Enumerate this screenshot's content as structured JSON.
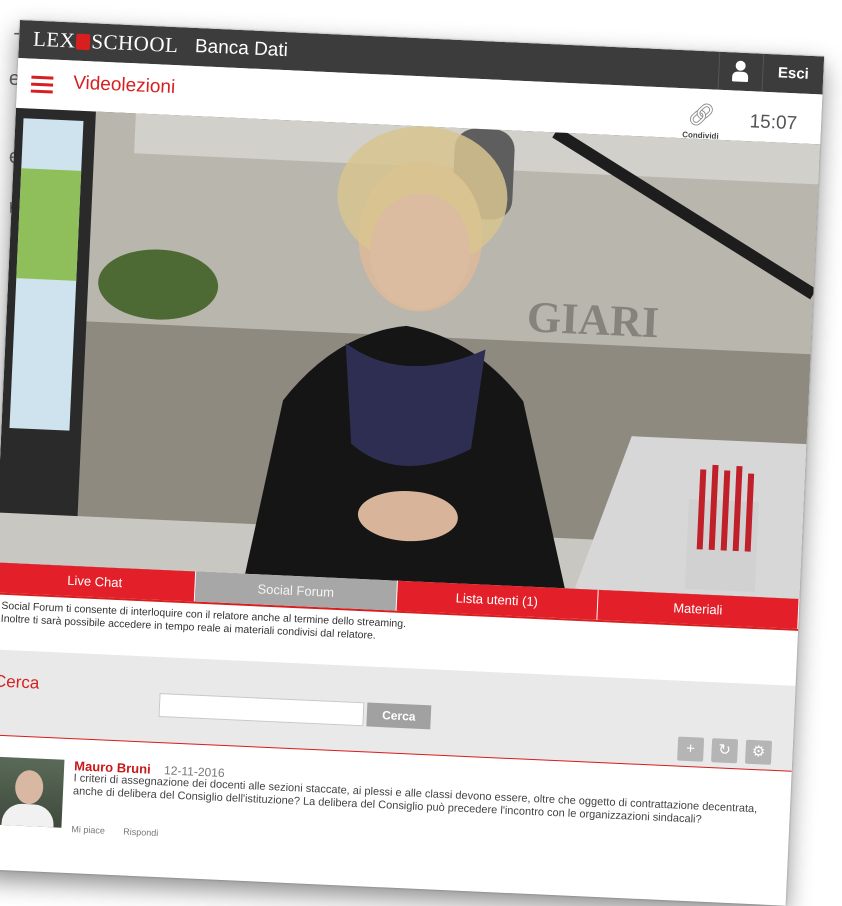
{
  "header": {
    "brand": "LEXSCHOOL",
    "brand_parts": [
      "LEX",
      "SCHOOL"
    ],
    "subtitle": "Banca Dati",
    "user_icon": "user-icon",
    "exit_label": "Esci"
  },
  "titlebar": {
    "title": "Videolezioni",
    "share_label": "Condividi",
    "time": "15:07"
  },
  "video": {
    "wall_text": "GIARI"
  },
  "tabs": [
    {
      "label": "Live Chat",
      "active": false
    },
    {
      "label": "Social Forum",
      "active": true
    },
    {
      "label": "Lista utenti  (1)",
      "active": false
    },
    {
      "label": "Materiali",
      "active": false
    }
  ],
  "info": {
    "line1": "Social Forum ti consente di interloquire con il relatore anche al termine dello streaming.",
    "line2": "Inoltre ti sarà possibile accedere in tempo reale ai materiali condivisi dal relatore."
  },
  "search": {
    "label": "Cerca",
    "value": "",
    "button_label": "Cerca",
    "tool_add": "+",
    "tool_refresh": "↻",
    "tool_settings": "⚙"
  },
  "comment": {
    "author": "Mauro Bruni",
    "date": "12-11-2016",
    "text": "I criteri di assegnazione dei docenti alle sezioni staccate, ai plessi e alle classi devono essere, oltre che oggetto di contrattazione decentrata, anche di delibera del Consiglio dell'istituzione? La delibera del Consiglio può precedere l'incontro con le organizzazioni sindacali?",
    "like_label": "Mi piace",
    "reply_label": "Rispondi"
  },
  "background_text": [
    "-",
    "e",
    "e",
    "i",
    "n"
  ],
  "colors": {
    "accent": "#d81e1e",
    "tab_red": "#e3202a",
    "tab_inactive": "#a7a7a7",
    "topbar": "#3c3c3c"
  }
}
